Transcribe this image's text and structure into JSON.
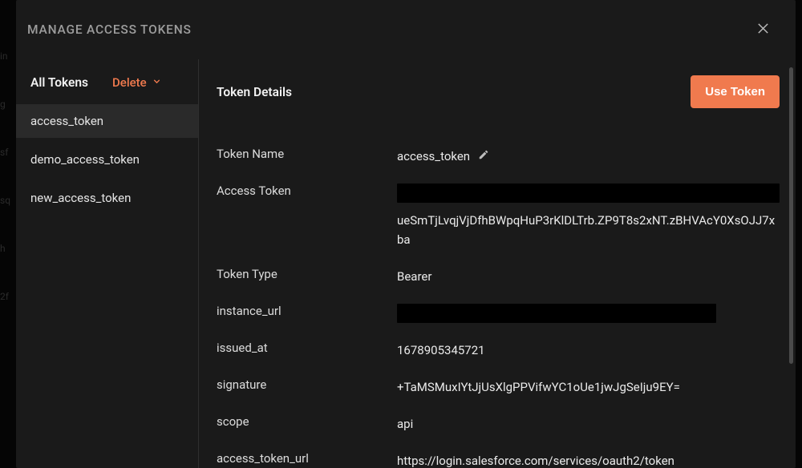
{
  "modal": {
    "title": "MANAGE ACCESS TOKENS"
  },
  "sidebar": {
    "all_tokens_label": "All Tokens",
    "delete_label": "Delete",
    "tokens": [
      {
        "name": "access_token",
        "active": true
      },
      {
        "name": "demo_access_token",
        "active": false
      },
      {
        "name": "new_access_token",
        "active": false
      }
    ]
  },
  "details": {
    "title": "Token Details",
    "use_button": "Use Token",
    "fields": {
      "token_name_label": "Token Name",
      "token_name_value": "access_token",
      "access_token_label": "Access Token",
      "access_token_visible": "ueSmTjLvqjVjDfhBWpqHuP3rKlDLTrb.ZP9T8s2xNT.zBHVAcY0XsOJJ7xba",
      "token_type_label": "Token Type",
      "token_type_value": "Bearer",
      "instance_url_label": "instance_url",
      "issued_at_label": "issued_at",
      "issued_at_value": "1678905345721",
      "signature_label": "signature",
      "signature_value": "+TaMSMuxIYtJjUsXlgPPVifwYC1oUe1jwJgSeIju9EY=",
      "scope_label": "scope",
      "scope_value": "api",
      "access_token_url_label": "access_token_url",
      "access_token_url_value": "https://login.salesforce.com/services/oauth2/token"
    }
  },
  "bg_fragments": [
    "in",
    "g",
    "sf",
    "sq",
    "h",
    "2f"
  ]
}
